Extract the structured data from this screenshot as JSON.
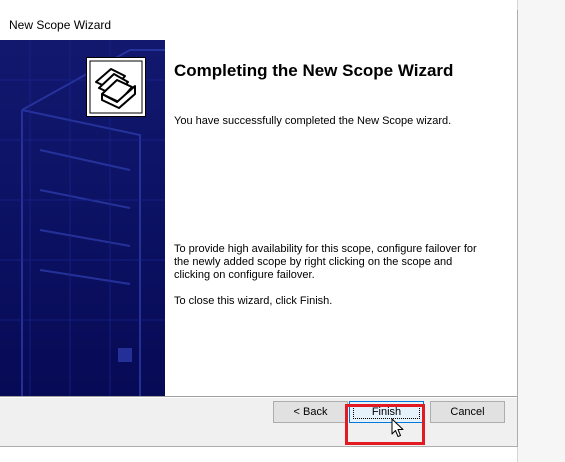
{
  "window": {
    "title": "New Scope Wizard"
  },
  "banner": {
    "icon": "folder-icon"
  },
  "content": {
    "heading": "Completing the New Scope Wizard",
    "success_text": "You have successfully completed the New Scope wizard.",
    "failover_text": "To provide high availability for this scope, configure failover for the newly added scope by right clicking on the scope and clicking on configure failover.",
    "close_text": "To close this wizard, click Finish."
  },
  "buttons": {
    "back": "< Back",
    "finish": "Finish",
    "cancel": "Cancel"
  },
  "colors": {
    "banner": "#0c1264",
    "highlight": "#e21b23",
    "focus": "#0078d7"
  }
}
